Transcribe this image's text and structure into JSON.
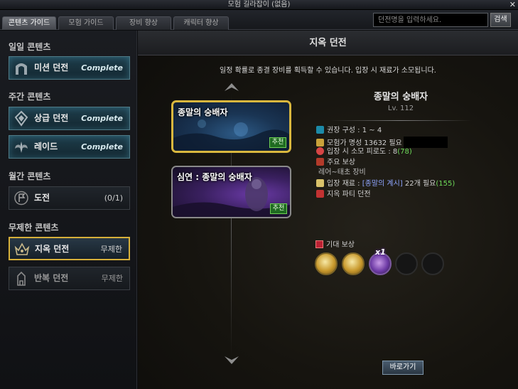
{
  "window": {
    "title": "모험 길라잡이 (없음)",
    "close_label": "✕"
  },
  "tabs": [
    {
      "label": "콘텐츠 가이드",
      "active": true
    },
    {
      "label": "모험 가이드",
      "active": false
    },
    {
      "label": "장비 향상",
      "active": false
    },
    {
      "label": "캐릭터 향상",
      "active": false
    }
  ],
  "search": {
    "placeholder": "던전명을 입력하세요.",
    "value": "",
    "button": "검색"
  },
  "sidebar": {
    "daily": {
      "label": "일일 콘텐츠",
      "items": [
        {
          "label": "미션 던전",
          "status": "Complete",
          "icon": "gate-icon"
        }
      ]
    },
    "weekly": {
      "label": "주간 콘텐츠",
      "items": [
        {
          "label": "상급 던전",
          "status": "Complete",
          "icon": "crest-icon"
        },
        {
          "label": "레이드",
          "status": "Complete",
          "icon": "wings-icon"
        }
      ]
    },
    "monthly": {
      "label": "월간 콘텐츠",
      "items": [
        {
          "label": "도전",
          "status": "(0/1)",
          "icon": "flag-icon"
        }
      ]
    },
    "unlimited": {
      "label": "무제한 콘텐츠",
      "items": [
        {
          "label": "지옥 던전",
          "status": "무제한",
          "icon": "hell-crown-icon",
          "selected": true
        },
        {
          "label": "반복 던전",
          "status": "무제한",
          "icon": "tower-icon"
        }
      ]
    }
  },
  "main": {
    "title": "지옥 던전",
    "description": "일정 확률로 종결 장비를 획득할 수 있습니다. 입장 시 재료가 소모됩니다.",
    "dungeons": [
      {
        "name": "종말의 숭배자",
        "badge": "추천",
        "selected": true
      },
      {
        "name": "심연 : 종말의 숭배자",
        "badge": "추천",
        "selected": false
      }
    ],
    "detail": {
      "name": "종말의 숭배자",
      "level": "Lv. 112",
      "party": {
        "prefix": "권장 구성 : ",
        "value": "1 ~ 4"
      },
      "fame": {
        "prefix": "모험가 명성 ",
        "value": "13632",
        "suffix": " 필요"
      },
      "fatigue": {
        "prefix": "입장 시 소모 피로도 : ",
        "value": "8",
        "extra": "(78)"
      },
      "reward_main_label": "주요 보상",
      "reward_main_value": "레어~태초 장비",
      "material": {
        "prefix": "입장 재료 : ",
        "name": "[종말의 계시]",
        "count": " 22개 필요",
        "have": "(155)"
      },
      "party_type": "지옥 파티 던전"
    },
    "expected_reward": {
      "label": "기대 보상",
      "multiplier": "x1",
      "slots": [
        "gold-equipment-icon",
        "gold-mystery-icon",
        "purple-emblem-icon",
        "empty",
        "empty"
      ]
    },
    "go_button": "바로가기"
  },
  "colors": {
    "selected_border": "#d9b73e",
    "complete_text": "#d6e9ee",
    "recommend_badge": "#1f6a21",
    "material_text": "#8fa6ff",
    "count_text": "#6fdc5a"
  }
}
